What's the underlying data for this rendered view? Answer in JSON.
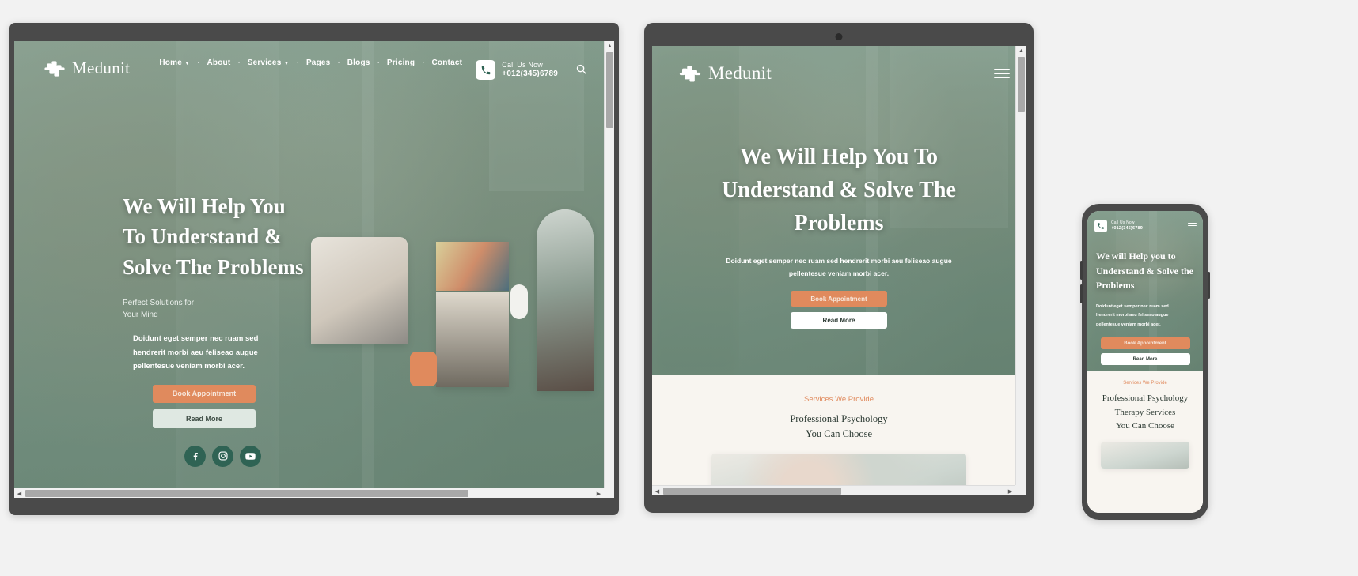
{
  "brand": {
    "name": "Medunit",
    "logo_icon": "medical-cross-pulse-logo"
  },
  "nav": {
    "items": [
      {
        "label": "Home",
        "has_caret": true
      },
      {
        "label": "About",
        "has_caret": false
      },
      {
        "label": "Services",
        "has_caret": true
      },
      {
        "label": "Pages",
        "has_caret": false
      },
      {
        "label": "Blogs",
        "has_caret": false
      },
      {
        "label": "Pricing",
        "has_caret": false
      },
      {
        "label": "Contact",
        "has_caret": false
      }
    ],
    "separator": "·"
  },
  "call": {
    "label": "Call Us Now",
    "number": "+012(345)6789",
    "icon": "phone-icon"
  },
  "search": {
    "icon": "search-icon"
  },
  "hero": {
    "heading": "We Will Help You To Understand & Solve The Problems",
    "heading_tablet": "We Will Help You To Understand & Solve The Problems",
    "heading_mobile": "We will Help you to Understand & Solve the Problems",
    "subtitle_line1": "Perfect Solutions for",
    "subtitle_line2": "Your Mind",
    "paragraph": "Doidunt eget semper nec ruam sed hendrerit morbi aeu feliseao augue pellentesue veniam morbi acer.",
    "primary_button": "Book Appointment",
    "secondary_button": "Read More"
  },
  "socials": [
    {
      "name": "facebook-icon",
      "glyph": "f"
    },
    {
      "name": "instagram-icon",
      "glyph": "◎"
    },
    {
      "name": "youtube-icon",
      "glyph": "▶"
    }
  ],
  "services": {
    "eyebrow": "Services We Provide",
    "title_line1": "Professional Psychology",
    "title_line2": "Therapy Services",
    "title_line3": "You Can Choose",
    "title_mobile_line1": "Professional Psychology",
    "title_mobile_line2": "Therapy Services",
    "title_mobile_line3": "You Can Choose"
  },
  "colors": {
    "accent": "#e08a5d",
    "brand_green": "#2f6354",
    "hero_overlay": "#6d8b78",
    "frame": "#4a4a4a",
    "page_bg": "#f2f2f2",
    "section_bg": "#f8f5f0"
  },
  "devices": {
    "desktop_label": "desktop-preview",
    "tablet_label": "tablet-preview",
    "mobile_label": "mobile-preview"
  },
  "scrollbar": {
    "up": "▲",
    "down": "▼",
    "left": "◀",
    "right": "▶"
  }
}
